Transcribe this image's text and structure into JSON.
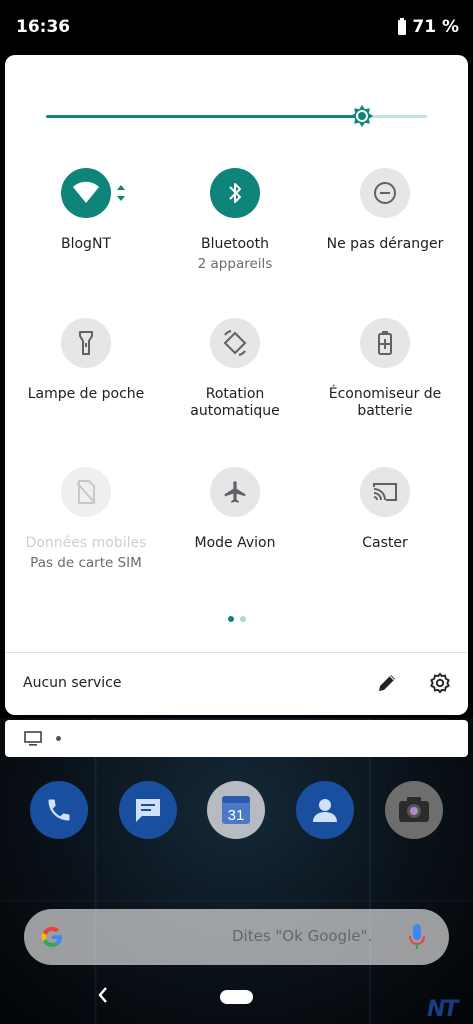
{
  "status_bar": {
    "time": "16:36",
    "battery": "71 %"
  },
  "brightness": {
    "level": 0.83
  },
  "tiles": [
    {
      "label": "BlogNT",
      "sub": "",
      "state": "on",
      "icon": "wifi-icon"
    },
    {
      "label": "Bluetooth",
      "sub": "2 appareils",
      "state": "on",
      "icon": "bluetooth-icon"
    },
    {
      "label": "Ne pas déranger",
      "sub": "",
      "state": "off",
      "icon": "do-not-disturb-icon"
    },
    {
      "label": "Lampe de poche",
      "sub": "",
      "state": "off",
      "icon": "flashlight-icon"
    },
    {
      "label": "Rotation automatique",
      "sub": "",
      "state": "off",
      "icon": "auto-rotate-icon"
    },
    {
      "label": "Économiseur de batterie",
      "sub": "",
      "state": "off",
      "icon": "battery-saver-icon"
    },
    {
      "label": "Données mobiles",
      "sub": "Pas de carte SIM",
      "state": "disabled",
      "icon": "mobile-data-off-icon"
    },
    {
      "label": "Mode Avion",
      "sub": "",
      "state": "off",
      "icon": "airplane-icon"
    },
    {
      "label": "Caster",
      "sub": "",
      "state": "off",
      "icon": "cast-icon"
    }
  ],
  "pager": {
    "pages": 2,
    "current": 1
  },
  "footer": {
    "carrier": "Aucun service"
  },
  "notification": {
    "icon": "screen-icon"
  },
  "dock": {
    "apps": [
      {
        "name": "phone",
        "icon": "phone-icon",
        "color": "#1a73e8"
      },
      {
        "name": "messages",
        "icon": "messages-icon",
        "color": "#1a73e8"
      },
      {
        "name": "calendar",
        "icon": "calendar-icon",
        "label": "31",
        "color": "#4285f4"
      },
      {
        "name": "contacts",
        "icon": "contacts-icon",
        "color": "#1a73e8"
      },
      {
        "name": "camera",
        "icon": "camera-icon",
        "color": "#555555"
      }
    ]
  },
  "search": {
    "hint": "Dites \"Ok Google\"."
  },
  "colors": {
    "accent": "#0f8478",
    "accent_light": "#bfe2e2"
  },
  "watermark": "NT"
}
